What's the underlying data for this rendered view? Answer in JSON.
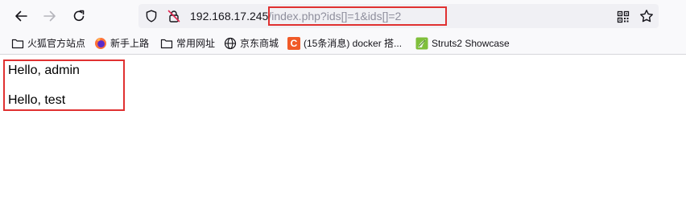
{
  "address_bar": {
    "host": "192.168.17.245",
    "path": "/index.php?ids[]=1&ids[]=2"
  },
  "bookmarks": [
    {
      "label": "火狐官方站点",
      "icon": "folder-icon"
    },
    {
      "label": "新手上路",
      "icon": "firefox-icon"
    },
    {
      "label": "常用网址",
      "icon": "folder-icon"
    },
    {
      "label": "京东商城",
      "icon": "globe-icon"
    },
    {
      "label": "(15条消息) docker 搭...",
      "icon": "csdn-icon",
      "icon_letter": "C"
    },
    {
      "label": "Struts2 Showcase",
      "icon": "struts-icon"
    }
  ],
  "page": {
    "lines": [
      "Hello, admin",
      "Hello, test"
    ]
  },
  "colors": {
    "highlight": "#e03131",
    "toolbar_bg": "#f9f9fb",
    "urlbar_bg": "#f0f0f4",
    "url_path": "#8f8f9d"
  }
}
